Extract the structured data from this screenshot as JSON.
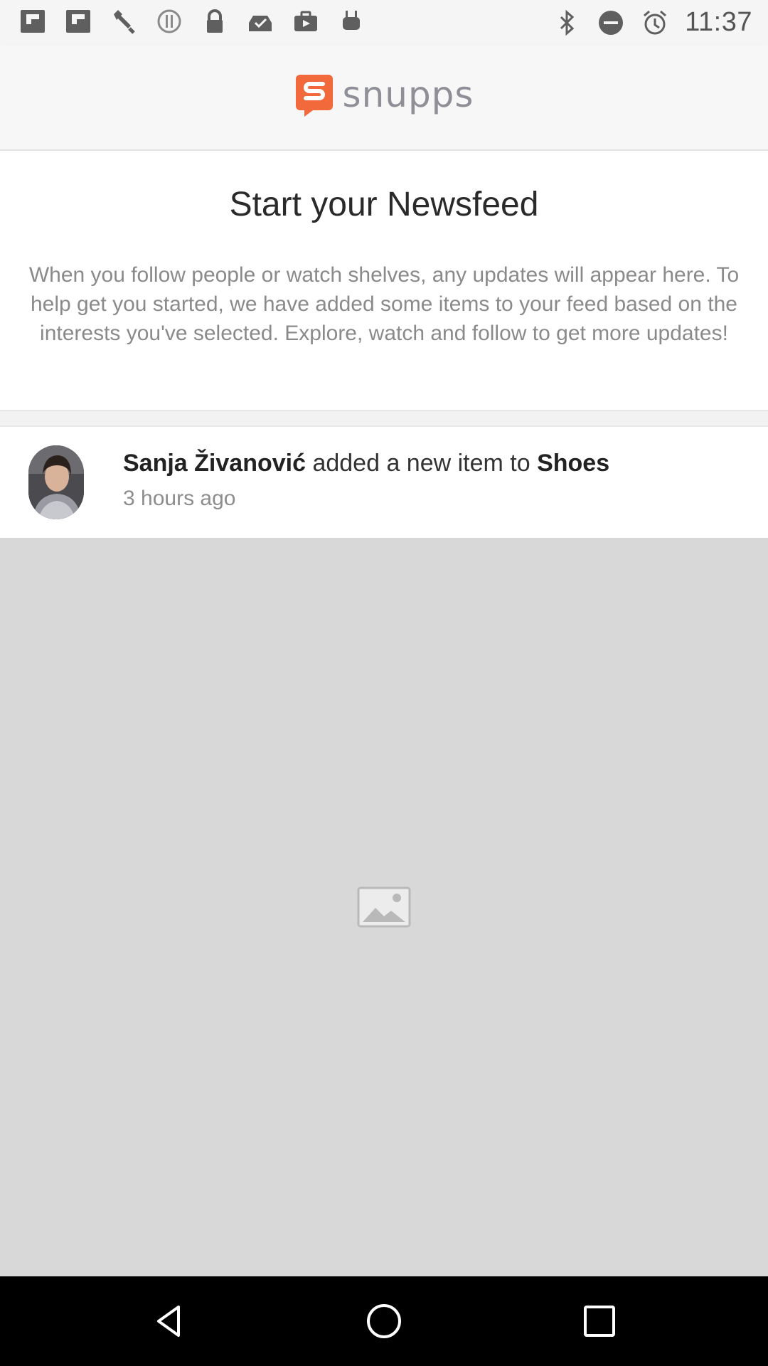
{
  "status_bar": {
    "time": "11:37",
    "left_icons": [
      "flipboard-icon",
      "flipboard-icon",
      "wrench-icon",
      "alert-icon",
      "lock-icon",
      "inbox-check-icon",
      "briefcase-icon",
      "android-icon"
    ],
    "right_icons": [
      "bluetooth-icon",
      "do-not-disturb-icon",
      "alarm-icon"
    ]
  },
  "header": {
    "logo_text": "snupps",
    "brand_color": "#f26a3b"
  },
  "intro": {
    "title": "Start your Newsfeed",
    "body": "When you follow people or watch shelves, any updates will appear here. To help get you started, we have added some items to your feed based on the interests you've selected. Explore, watch and follow to get more updates!"
  },
  "feed_item": {
    "user_name": "Sanja Živanović",
    "action_text": " added a new item to ",
    "shelf_name": "Shoes",
    "time_ago": "3 hours ago"
  },
  "placeholder": {
    "icon": "image-icon"
  },
  "nav_bar": {
    "buttons": [
      "back-icon",
      "home-icon",
      "recents-icon"
    ]
  }
}
